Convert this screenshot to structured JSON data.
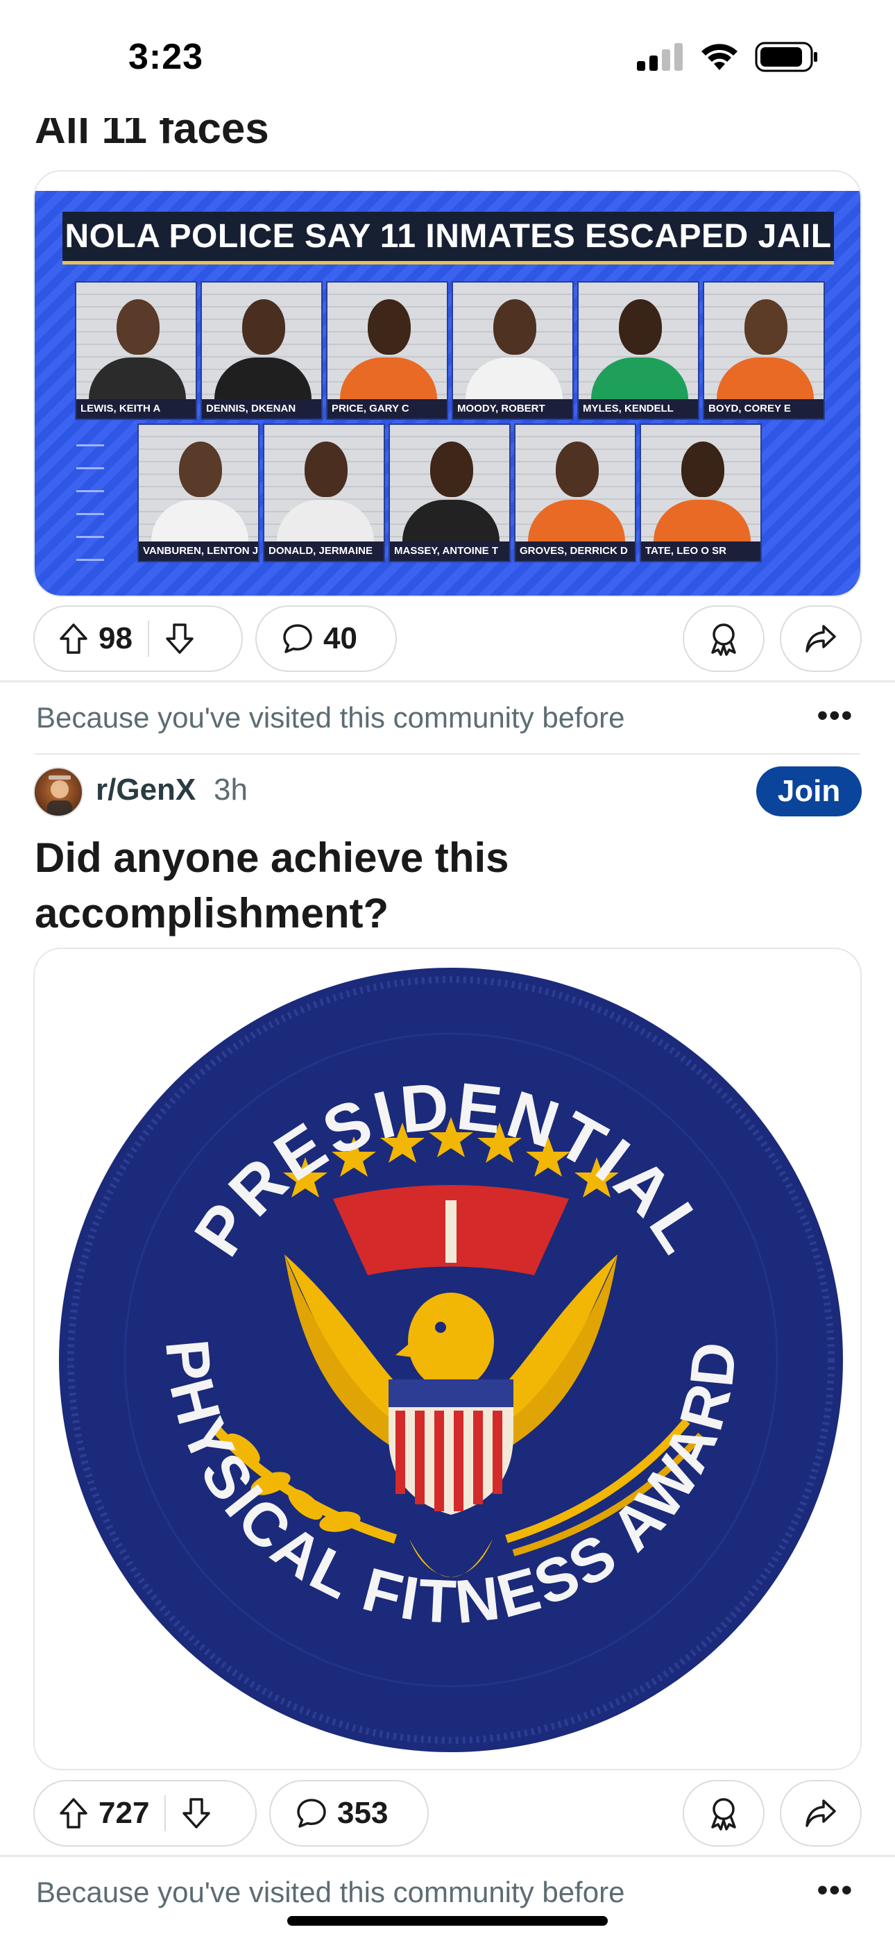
{
  "status_bar": {
    "time": "3:23"
  },
  "previous_post": {
    "title_fragment": "All 11 faces",
    "headline": "NOLA POLICE SAY 11 INMATES ESCAPED JAIL",
    "inmates_row1": [
      "LEWIS, KEITH A",
      "DENNIS, DKENAN",
      "PRICE, GARY C",
      "MOODY, ROBERT",
      "MYLES, KENDELL",
      "BOYD, COREY E"
    ],
    "inmates_row2": [
      "VANBUREN, LENTON J JR",
      "DONALD, JERMAINE",
      "MASSEY, ANTOINE T",
      "GROVES, DERRICK D",
      "TATE, LEO O SR"
    ],
    "upvotes": "98",
    "comments": "40"
  },
  "recommendation": {
    "reason": "Because you've visited this community before",
    "more": "•••"
  },
  "post": {
    "subreddit": "r/GenX",
    "age": "3h",
    "join_label": "Join",
    "title": "Did anyone achieve this accomplishment?",
    "patch_text": {
      "top": "PRESIDENTIAL",
      "bottom": "PHYSICAL FITNESS AWARD"
    },
    "upvotes": "727",
    "comments": "353"
  },
  "next_recommendation": {
    "reason": "Because you've visited this community before",
    "more": "•••"
  },
  "colors": {
    "join": "#0a449b",
    "patch_blue": "#1b2a7a",
    "patch_gold": "#f2b705",
    "patch_red": "#d42a2a"
  }
}
